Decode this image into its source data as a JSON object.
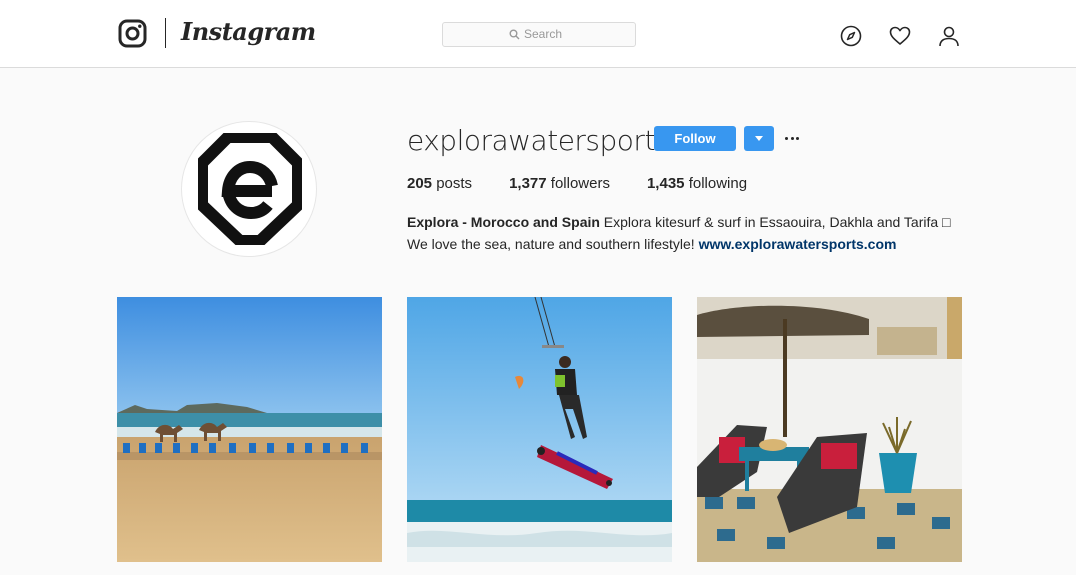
{
  "header": {
    "brand": "Instagram",
    "search": {
      "placeholder": "Search",
      "value": ""
    },
    "icons": [
      "instagram-glyph-icon",
      "compass-icon",
      "heart-icon",
      "user-icon"
    ]
  },
  "profile": {
    "username": "explorawatersports",
    "follow_label": "Follow",
    "stats": {
      "posts_count": "205",
      "posts_label": "posts",
      "followers_count": "1,377",
      "followers_label": "followers",
      "following_count": "1,435",
      "following_label": "following"
    },
    "bio": {
      "name": "Explora - Morocco and Spain",
      "text_line1": " Explora kitesurf & surf in Essaouira, Dakhla and Tarifa □",
      "text_line2": "We love the sea, nature and southern lifestyle! ",
      "link": "www.explorawatersports.com"
    }
  },
  "colors": {
    "accent": "#3897f0",
    "link": "#003569",
    "border": "#dbdbdb"
  },
  "posts": [
    {
      "subject": "camels on beach"
    },
    {
      "subject": "kitesurfer jumping"
    },
    {
      "subject": "terrace with lounge chairs"
    }
  ]
}
